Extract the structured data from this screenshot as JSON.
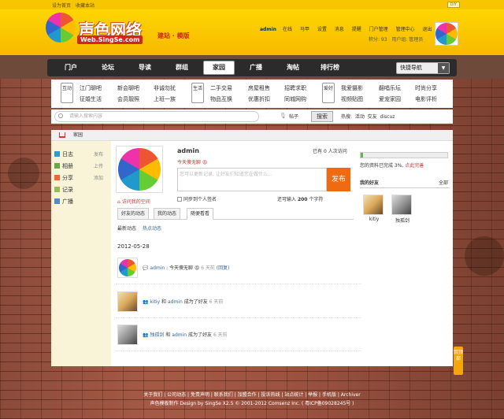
{
  "topbar": {
    "set_home": "设为首页",
    "favorite": "收藏本站",
    "diy": "DIY"
  },
  "header": {
    "logo_text": "声色网络",
    "logo_url": "Web.SingSe.com",
    "tagline": "建站 · 模版",
    "user": {
      "name": "admin",
      "status": "在线",
      "links": [
        "马甲",
        "设置",
        "消息",
        "提醒",
        "门户管理",
        "管理中心",
        "退出"
      ],
      "credits": "积分: 93",
      "group": "用户组: 管理员"
    }
  },
  "nav": {
    "items": [
      "门户",
      "论坛",
      "导读",
      "群组",
      "家园",
      "广播",
      "淘帖",
      "排行榜"
    ],
    "active": "家园",
    "quick": "快捷导航"
  },
  "subnav": {
    "groups": [
      {
        "tag": "互动",
        "links": [
          "江门聊吧",
          "新会聊吧",
          "非诚勿扰",
          "征婚生活",
          "会员靓照",
          "上班一族"
        ]
      },
      {
        "tag": "生活",
        "links": [
          "二手交易",
          "房屋租售",
          "招聘求职",
          "物品互换",
          "优惠折扣",
          "同城网购"
        ]
      },
      {
        "tag": "爱好",
        "links": [
          "我爱摄影",
          "翻唱乐坛",
          "时尚分享",
          "视频贴图",
          "爱宠家园",
          "电影评析"
        ]
      }
    ]
  },
  "search": {
    "placeholder": "请输入搜索内容",
    "field": "帖子",
    "button": "搜索",
    "hot_label": "热搜:",
    "hot": [
      "活动",
      "交友",
      "discuz"
    ]
  },
  "breadcrumb": "家园",
  "left_menu": [
    {
      "icon": "blog-icon",
      "label": "日志",
      "action": "发布"
    },
    {
      "icon": "album-icon",
      "label": "相册",
      "action": "上传"
    },
    {
      "icon": "share-icon",
      "label": "分享",
      "action": "添加"
    },
    {
      "icon": "record-icon",
      "label": "记录",
      "action": ""
    },
    {
      "icon": "broadcast-icon",
      "label": "广播",
      "action": ""
    }
  ],
  "profile": {
    "name": "admin",
    "status": "今天傻无聊",
    "visits_prefix": "已有",
    "visits_count": "0",
    "visits_suffix": "人次访问",
    "textarea_placeholder": "您可以更新记录, 让好友们知道您在做什么...",
    "publish": "发布",
    "sync": "同步到个人签名",
    "remain_prefix": "还可输入",
    "remain_count": "200",
    "remain_suffix": "个字符",
    "visit_space": "访问我的空间"
  },
  "tabs": [
    "好友的动态",
    "我的动态",
    "随便看看"
  ],
  "active_tab": "随便看看",
  "subtabs": [
    "最新动态",
    "热点动态"
  ],
  "feed": {
    "date": "2012-05-28",
    "items": [
      {
        "user": "admin",
        "text": ": 今天傻无聊",
        "time": "6 天前",
        "extra": "(回复)"
      },
      {
        "user": "kitiy",
        "mid": "和",
        "user2": "admin",
        "text": "成为了好友",
        "time": "6 天前"
      },
      {
        "user": "独孤剑",
        "mid": "和",
        "user2": "admin",
        "text": "成为了好友",
        "time": "6 天前"
      }
    ]
  },
  "right": {
    "progress_label": "您的资料已完成 3%,",
    "progress_link": "点此完善",
    "progress": 0.03,
    "friends_title": "我的好友",
    "friends_all": "全部",
    "friends": [
      "kitiy",
      "独孤剑"
    ]
  },
  "backtop": "回顶部",
  "footer": {
    "links": "关于我们 | 公司动态 | 免责声明 | 联系我们 | 加盟合作 | 投诉热线 | 站点统计 | 举报 | 手机版 | Archiver",
    "copyright": "声色模板制作 Design by SingSe X2.5 © 2001-2012 Comsenz Inc. ( 粤ICP备09028245号 )"
  }
}
